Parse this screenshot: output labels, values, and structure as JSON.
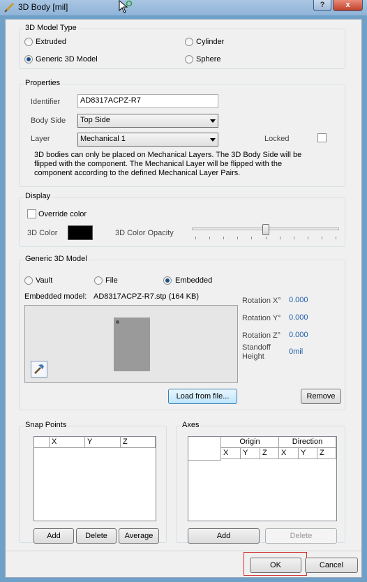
{
  "window": {
    "title": "3D Body [mil]",
    "help_label": "?",
    "close_label": "x"
  },
  "model_type": {
    "title": "3D Model Type",
    "options": [
      "Extruded",
      "Generic 3D Model",
      "Cylinder",
      "Sphere"
    ],
    "selected": "Generic 3D Model"
  },
  "properties": {
    "title": "Properties",
    "identifier_label": "Identifier",
    "identifier_value": "AD8317ACPZ-R7",
    "body_side_label": "Body Side",
    "body_side_value": "Top Side",
    "layer_label": "Layer",
    "layer_value": "Mechanical 1",
    "locked_label": "Locked",
    "locked_checked": false,
    "info_lines": [
      "3D bodies can only be placed on Mechanical Layers. The 3D Body Side will be",
      "flipped with the component. The Mechanical Layer will be flipped with the",
      "component according to the defined Mechanical Layer Pairs."
    ]
  },
  "display": {
    "title": "Display",
    "override_color_label": "Override color",
    "override_color_checked": false,
    "color_label": "3D Color",
    "color_value": "#000000",
    "opacity_label": "3D Color Opacity",
    "opacity_level": 0.5
  },
  "generic_model": {
    "title": "Generic 3D Model",
    "source_options": [
      "Vault",
      "File",
      "Embedded"
    ],
    "selected_source": "Embedded",
    "embedded_label": "Embedded model:",
    "embedded_value": "AD8317ACPZ-R7.stp (164 KB)",
    "rotation_x_label": "Rotation X°",
    "rotation_x_value": "0.000",
    "rotation_y_label": "Rotation Y°",
    "rotation_y_value": "0.000",
    "rotation_z_label": "Rotation Z°",
    "rotation_z_value": "0.000",
    "standoff_label_1": "Standoff",
    "standoff_label_2": "Height",
    "standoff_value": "0mil",
    "load_button": "Load from file...",
    "remove_button": "Remove"
  },
  "snap_points": {
    "title": "Snap Points",
    "columns": [
      "X",
      "Y",
      "Z"
    ],
    "add_button": "Add",
    "delete_button": "Delete",
    "average_button": "Average"
  },
  "axes": {
    "title": "Axes",
    "group_headers": [
      "Origin",
      "Direction"
    ],
    "columns": [
      "X",
      "Y",
      "Z",
      "X",
      "Y",
      "Z"
    ],
    "add_button": "Add",
    "delete_button": "Delete"
  },
  "footer": {
    "ok_button": "OK",
    "cancel_button": "Cancel"
  }
}
